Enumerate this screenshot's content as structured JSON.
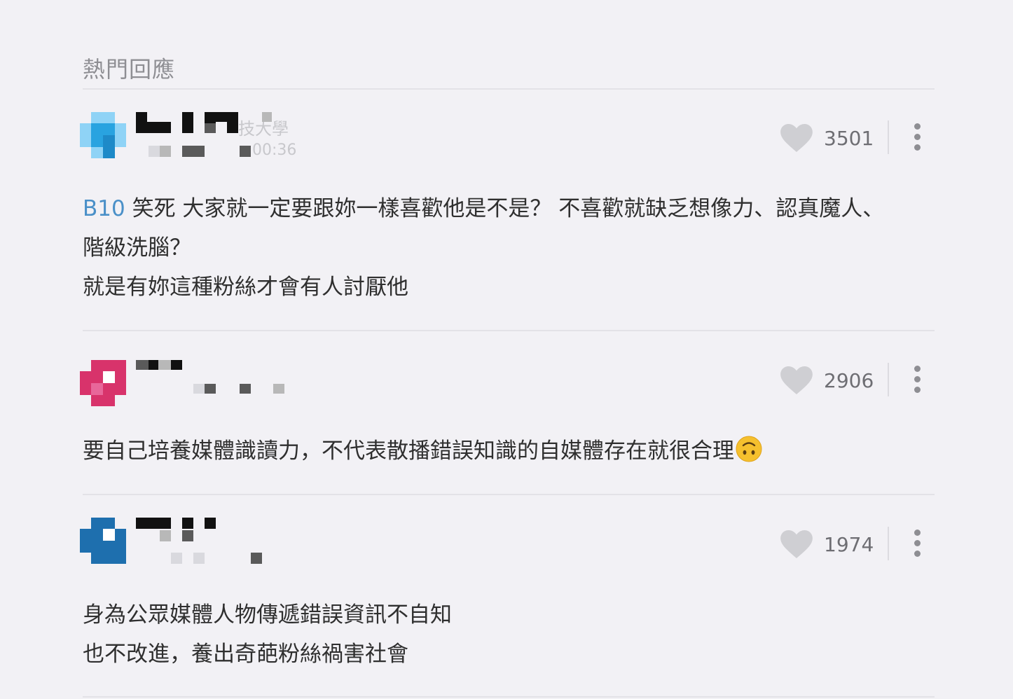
{
  "section": {
    "title": "熱門回應"
  },
  "comments": [
    {
      "author_visible": "技大學",
      "time_visible": "00:36",
      "likes": "3501",
      "floor": "B10",
      "lines": [
        "笑死 大家就一定要跟妳一樣喜歡他是不是？ 不喜歡就缺乏想像力、認真魔人、",
        "階級洗腦？",
        "就是有妳這種粉絲才會有人討厭他"
      ],
      "avatar_color": "#29a3e0"
    },
    {
      "likes": "2906",
      "lines": [
        "要自己培養媒體識讀力，不代表散播錯誤知識的自媒體存在就很合理"
      ],
      "emoji": "upside-down-face",
      "avatar_color": "#d8336b"
    },
    {
      "likes": "1974",
      "lines": [
        "身為公眾媒體人物傳遞錯誤資訊不自知",
        "也不改進，養出奇葩粉絲禍害社會"
      ],
      "avatar_color": "#1e6fae"
    }
  ],
  "icons": {
    "like": "heart-icon",
    "more": "more-vertical-icon"
  },
  "colors": {
    "background": "#f2f1f5",
    "floor_link": "#4a90c8",
    "muted": "#8e8e93"
  }
}
